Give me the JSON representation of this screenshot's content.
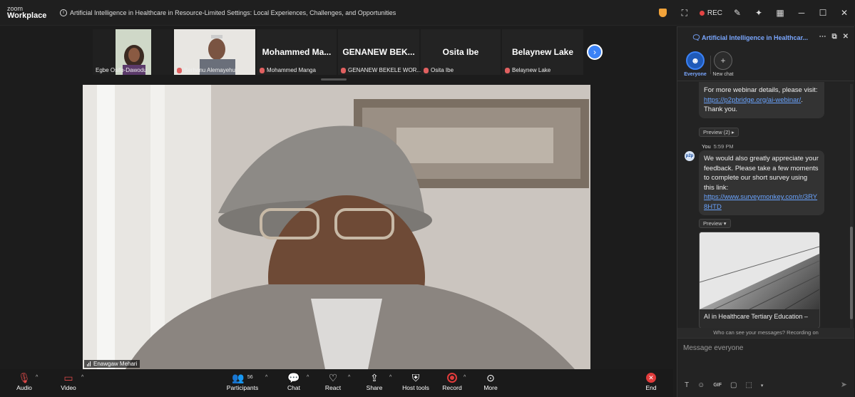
{
  "app": {
    "brand_top": "zoom",
    "brand_bottom": "Workplace"
  },
  "meeting": {
    "title": "Artificial Intelligence in Healthcare in Resource-Limited Settings: Local Experiences, Challenges, and Opportunities"
  },
  "titlebar": {
    "rec_label": "REC"
  },
  "gallery": {
    "participants": [
      {
        "name": "Egbe Osifo-Dawodu",
        "muted": false
      },
      {
        "name": "Berhanu Alemayehu",
        "muted": true
      },
      {
        "name": "Mohammed Manga",
        "display": "Mohammed  Ma...",
        "muted": true
      },
      {
        "name": "GENANEW BEKELE WOR...",
        "display": "GENANEW  BEK...",
        "muted": true
      },
      {
        "name": "Osita Ibe",
        "display": "Osita Ibe",
        "muted": true
      },
      {
        "name": "Belaynew Lake",
        "display": "Belaynew Lake",
        "muted": true
      }
    ]
  },
  "speaker": {
    "name": "Enawgaw Mehari"
  },
  "chat": {
    "title": "Artificial Intelligence in Healthcar...",
    "tabs": [
      {
        "label": "Everyone",
        "active": true
      },
      {
        "label": "New chat",
        "active": false
      }
    ],
    "messages": [
      {
        "text_before": "For more webinar details, please visit: ",
        "link": "https://p2pbridge.org/ai-webinar/",
        "text_after": ".",
        "line2": "Thank you.",
        "preview": "Preview (2) ▸"
      },
      {
        "sender": "You",
        "time": "5:59 PM",
        "avatar": "p2p",
        "text": "We would also greatly appreciate your feedback. Please take a few moments to complete our short survey using this link:",
        "link": "https://www.surveymonkey.com/r/3RY8HTD",
        "preview": "Preview ▾",
        "card_caption": "AI in Healthcare Tertiary Education –"
      }
    ],
    "notice": "Who can see your messages? Recording on",
    "compose_placeholder": "Message everyone"
  },
  "toolbar": {
    "audio": "Audio",
    "video": "Video",
    "participants": "Participants",
    "participants_count": "56",
    "chat": "Chat",
    "react": "React",
    "share": "Share",
    "host_tools": "Host tools",
    "record": "Record",
    "more": "More",
    "end": "End"
  }
}
